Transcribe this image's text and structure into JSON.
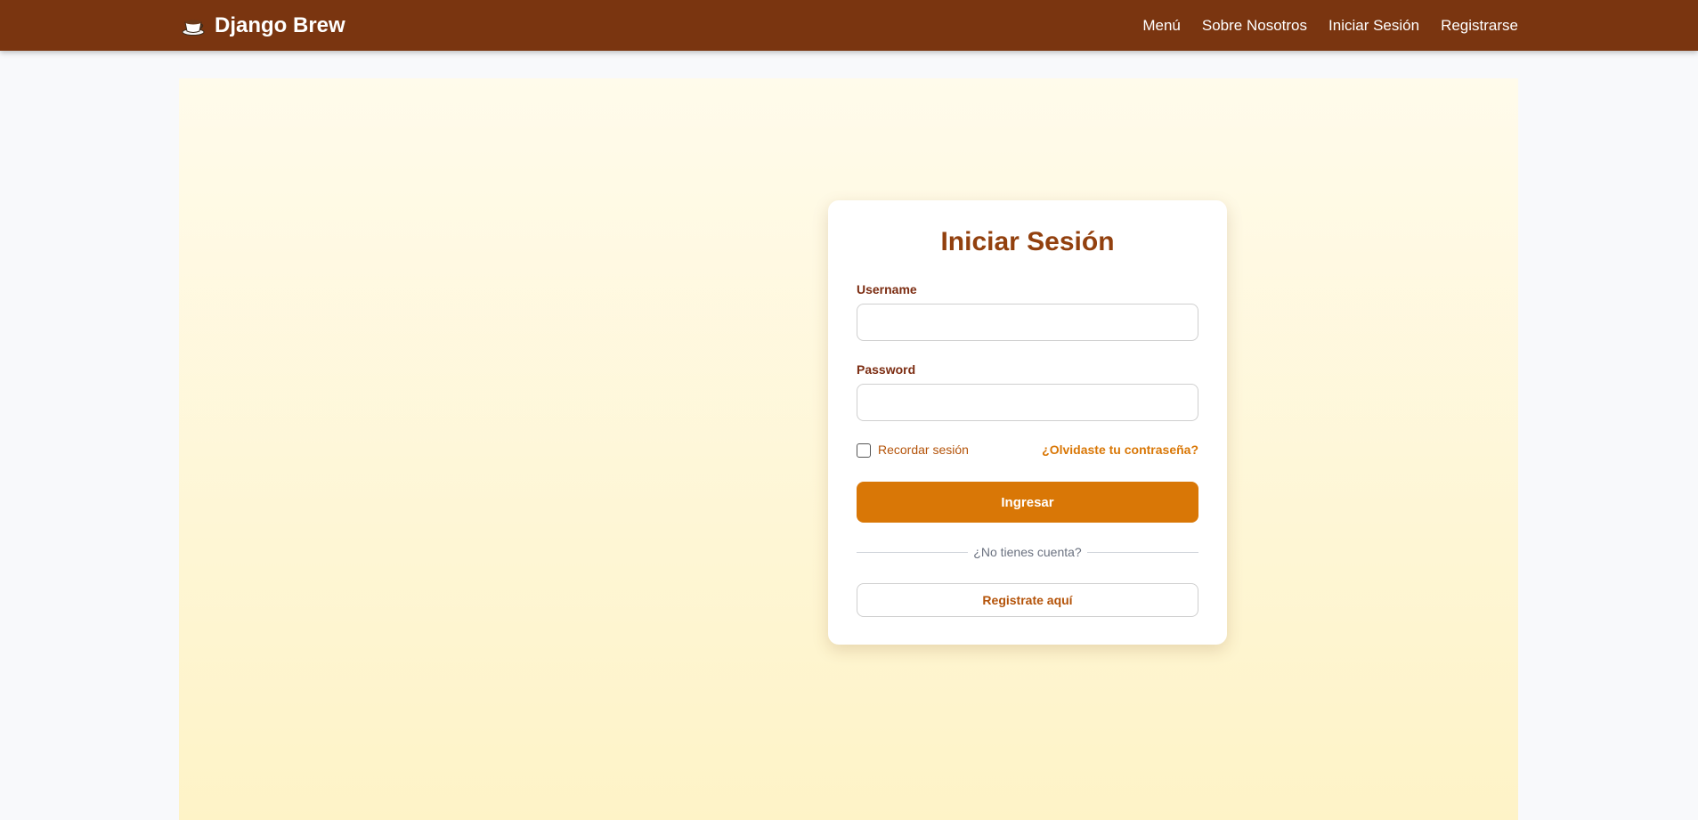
{
  "navbar": {
    "brand_icon": "coffee-cup-icon",
    "brand": "Django Brew",
    "links": [
      "Menú",
      "Sobre Nosotros",
      "Iniciar Sesión",
      "Registrarse"
    ]
  },
  "login": {
    "title": "Iniciar Sesión",
    "username_label": "Username",
    "username_value": "",
    "password_label": "Password",
    "password_value": "",
    "remember_label": "Recordar sesión",
    "remember_checked": false,
    "forgot_link": "¿Olvidaste tu contraseña?",
    "submit_label": "Ingresar",
    "divider_text": "¿No tienes cuenta?",
    "register_label": "Registrate aquí"
  },
  "colors": {
    "navbar_bg": "#7a3510",
    "title": "#92400e",
    "accent": "#d97706",
    "panel_top": "#fffbeb",
    "panel_bottom": "#fef3c7"
  }
}
